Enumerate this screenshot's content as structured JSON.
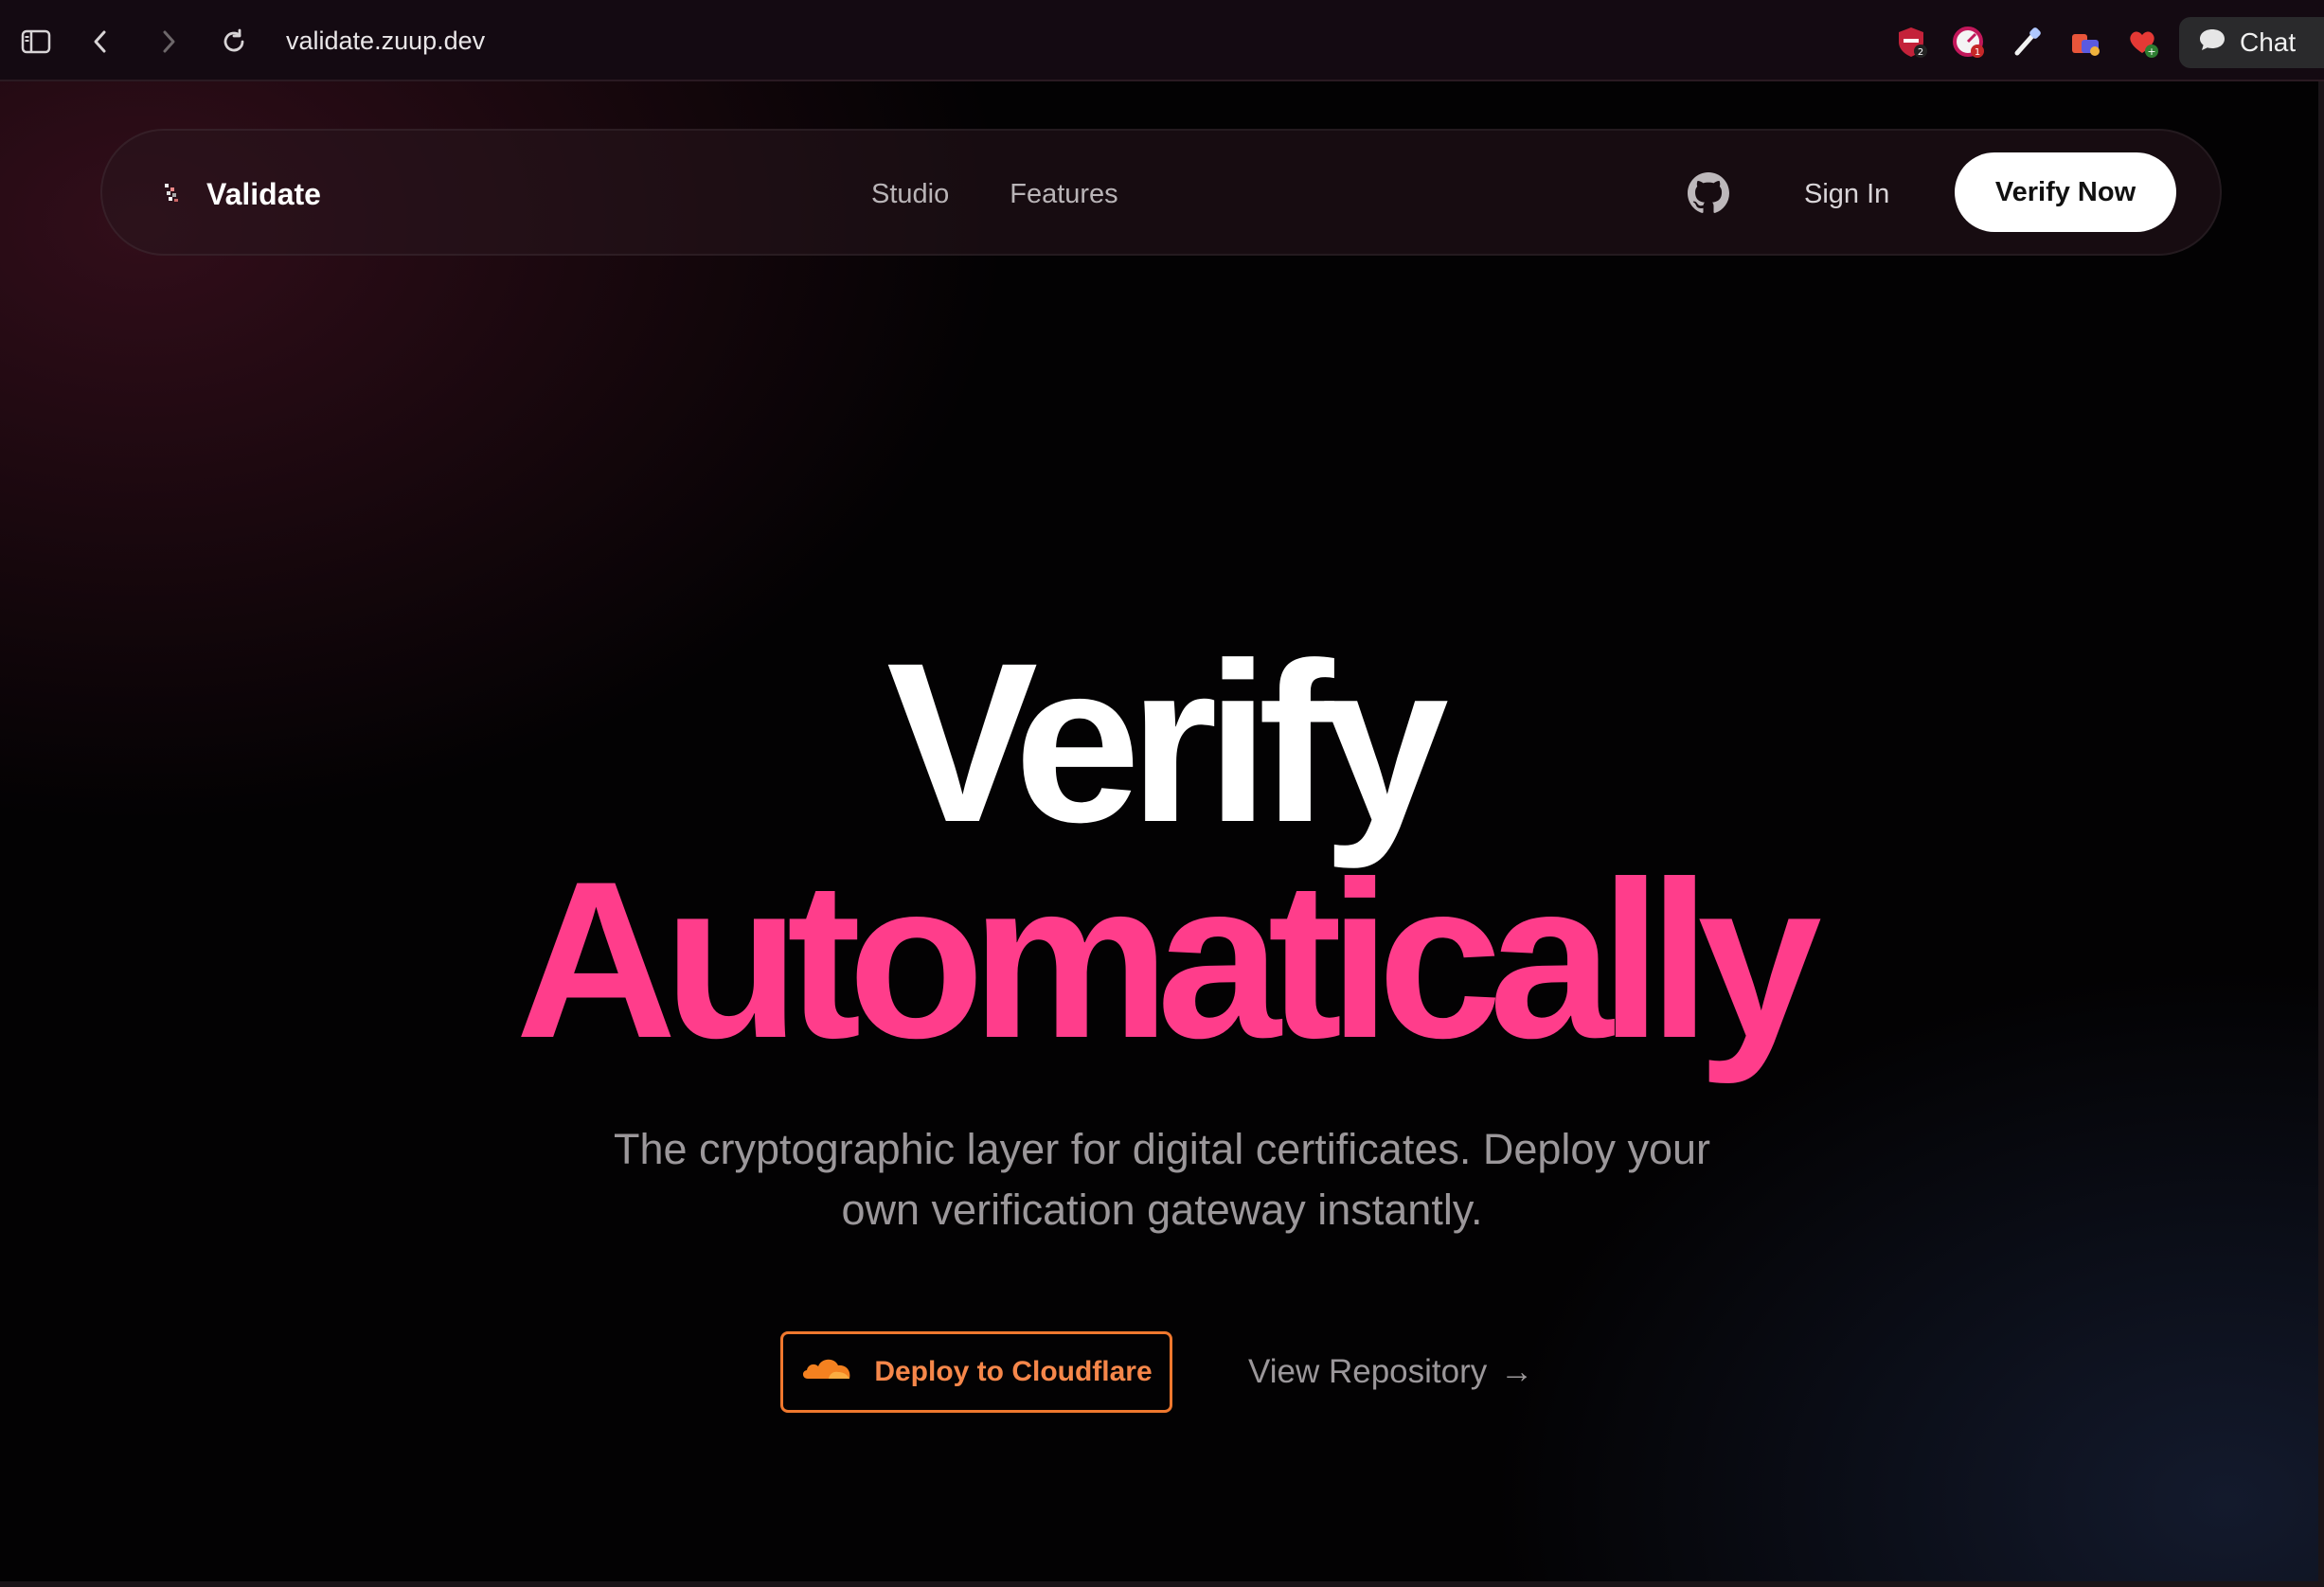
{
  "browser": {
    "url": "validate.zuup.dev",
    "chat_label": "Chat"
  },
  "nav": {
    "brand": "Validate",
    "links": [
      "Studio",
      "Features"
    ],
    "sign_in": "Sign In",
    "cta": "Verify Now"
  },
  "hero": {
    "line1": "Verify",
    "line2": "Automatically",
    "subtitle_line1": "The cryptographic layer for digital certificates. Deploy your",
    "subtitle_line2": "own verification gateway instantly.",
    "primary_button": "Deploy to Cloudflare",
    "secondary_link": "View Repository",
    "secondary_arrow": "→"
  },
  "colors": {
    "accent_pink": "#ff3d8b",
    "cloudflare_orange": "#f0782e"
  },
  "icons": [
    "sidebar-toggle-icon",
    "back-icon",
    "forward-icon",
    "reload-icon",
    "github-icon",
    "cloudflare-icon",
    "chat-icon"
  ]
}
